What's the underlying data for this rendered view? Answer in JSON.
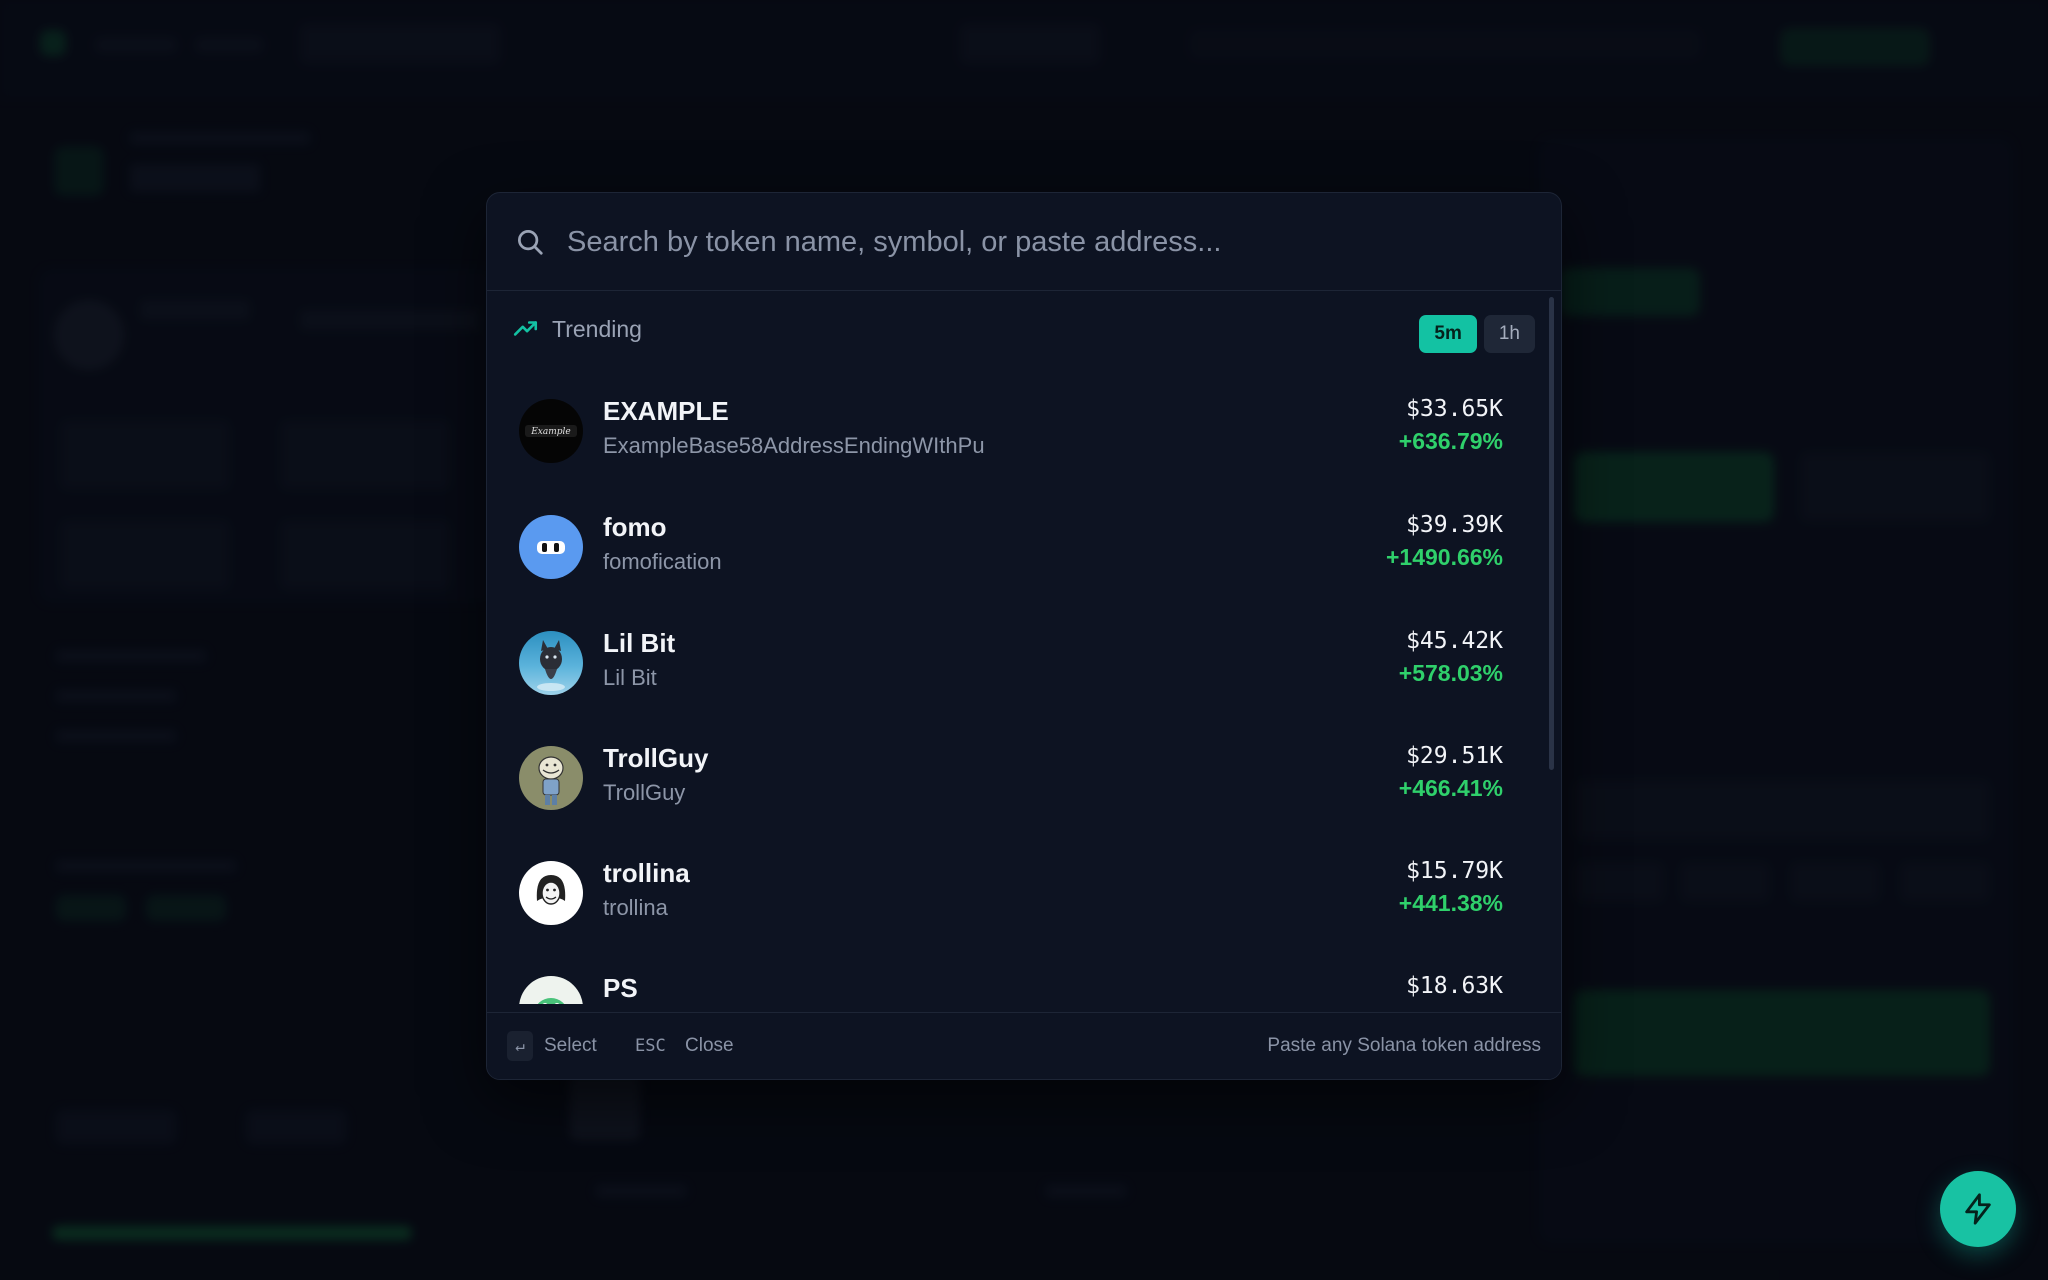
{
  "search": {
    "placeholder": "Search by token name, symbol, or paste address..."
  },
  "trending": {
    "label": "Trending",
    "timeframes": [
      "5m",
      "1h"
    ],
    "active_timeframe": "5m"
  },
  "tokens": [
    {
      "name": "EXAMPLE",
      "subtitle": "ExampleBase58AddressEndingWIthPu",
      "price": "$33.65K",
      "change": "+636.79%",
      "avatar_icon": "example-logo"
    },
    {
      "name": "fomo",
      "subtitle": "fomofication",
      "price": "$39.39K",
      "change": "+1490.66%",
      "avatar_icon": "fomo-eyes-logo"
    },
    {
      "name": "Lil Bit",
      "subtitle": "Lil Bit",
      "price": "$45.42K",
      "change": "+578.03%",
      "avatar_icon": "cat-photo"
    },
    {
      "name": "TrollGuy",
      "subtitle": "TrollGuy",
      "price": "$29.51K",
      "change": "+466.41%",
      "avatar_icon": "trollguy-cartoon"
    },
    {
      "name": "trollina",
      "subtitle": "trollina",
      "price": "$15.79K",
      "change": "+441.38%",
      "avatar_icon": "trollina-face"
    },
    {
      "name": "PS",
      "subtitle": "",
      "price": "$18.63K",
      "change": "",
      "avatar_icon": "green-creature"
    }
  ],
  "footer": {
    "enter_key": "↵",
    "select_label": "Select",
    "esc_key": "ESC",
    "close_label": "Close",
    "hint": "Paste any Solana token address"
  },
  "colors": {
    "accent": "#13c2a3",
    "positive": "#2fd06b",
    "modal_bg": "#0d1322"
  }
}
